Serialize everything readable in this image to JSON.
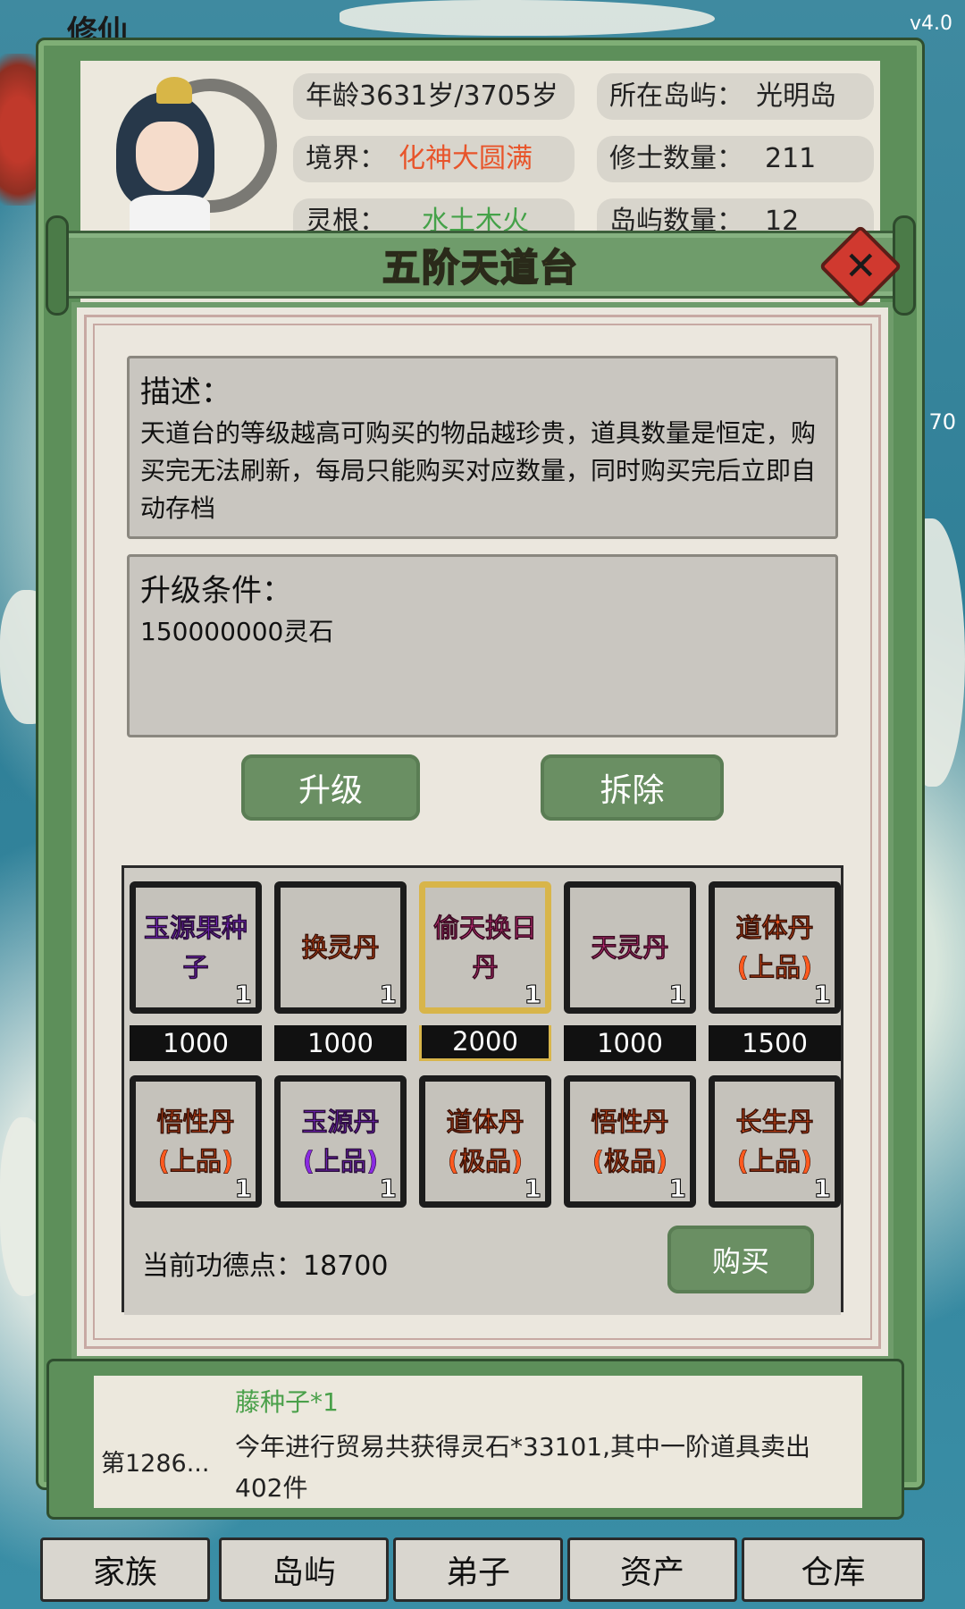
{
  "header": {
    "game_title": "修仙",
    "version": "v4.0"
  },
  "side_number": "70",
  "character": {
    "age_label": "年龄",
    "age_value": "3631岁/3705岁",
    "island_label": "所在岛屿：",
    "island_value": "光明岛",
    "realm_label": "境界：",
    "realm_value": "化神大圆满",
    "cultivators_label": "修士数量：",
    "cultivators_value": "211",
    "root_label": "灵根：",
    "root_value": "水土木火",
    "islands_label": "岛屿数量：",
    "islands_value": "12"
  },
  "modal": {
    "title": "五阶天道台",
    "close_icon": "close-icon",
    "description": {
      "title": "描述：",
      "text": "天道台的等级越高可购买的物品越珍贵，道具数量是恒定，购买完无法刷新，每局只能购买对应数量，同时购买完后立即自动存档"
    },
    "upgrade": {
      "title": "升级条件：",
      "text": "150000000灵石"
    },
    "upgrade_button": "升级",
    "demolish_button": "拆除",
    "shop_items": [
      {
        "name": "玉源果种子",
        "qty": "1",
        "price": "1000",
        "color": "#8a2be2"
      },
      {
        "name": "换灵丹",
        "qty": "1",
        "price": "1000",
        "color": "#ff5a1f"
      },
      {
        "name": "偷天换日丹",
        "qty": "1",
        "price": "2000",
        "color": "#e0368a"
      },
      {
        "name": "天灵丹",
        "qty": "1",
        "price": "1000",
        "color": "#e0368a"
      },
      {
        "name": "道体丹(上品)",
        "qty": "1",
        "price": "1500",
        "color": "#ff5a1f"
      },
      {
        "name": "悟性丹(上品)",
        "qty": "1",
        "color": "#ff5a1f"
      },
      {
        "name": "玉源丹(上品)",
        "qty": "1",
        "color": "#8a2be2"
      },
      {
        "name": "道体丹(极品)",
        "qty": "1",
        "color": "#ff5a1f"
      },
      {
        "name": "悟性丹(极品)",
        "qty": "1",
        "color": "#ff5a1f"
      },
      {
        "name": "长生丹(上品)",
        "qty": "1",
        "color": "#ff5a1f"
      }
    ],
    "merit_label": "当前功德点：",
    "merit_value": "18700",
    "buy_button": "购买"
  },
  "log": {
    "line1": "藤种子*1",
    "date": "第1286...",
    "line2": "今年进行贸易共获得灵石*33101,其中一阶道具卖出",
    "line3": "402件"
  },
  "tabs": [
    "家族",
    "岛屿",
    "弟子",
    "资产",
    "仓库"
  ]
}
